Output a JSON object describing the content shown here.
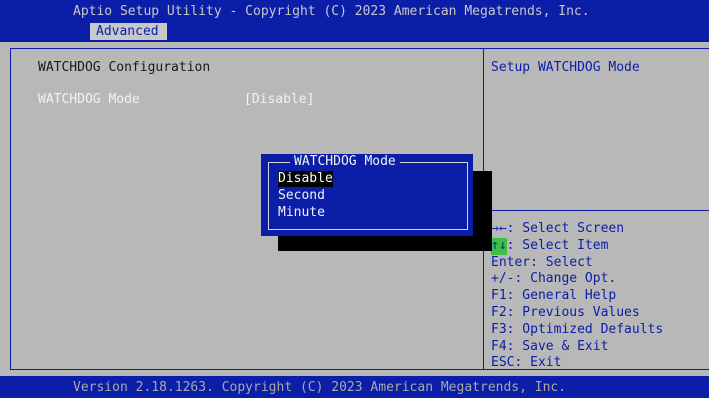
{
  "header": {
    "title": "Aptio Setup Utility - Copyright (C) 2023 American Megatrends, Inc.",
    "active_tab": "Advanced"
  },
  "main": {
    "section_title": "WATCHDOG Configuration",
    "settings": [
      {
        "label": "WATCHDOG Mode",
        "value": "[Disable]"
      }
    ]
  },
  "help": {
    "description": "Setup WATCHDOG Mode",
    "keys": [
      {
        "key": "→←",
        "text": ": Select Screen"
      },
      {
        "key": "↑↓",
        "text": ": Select Item"
      },
      {
        "key": "Enter",
        "text": ": Select"
      },
      {
        "key": "+/-",
        "text": ": Change Opt."
      },
      {
        "key": "F1",
        "text": ": General Help"
      },
      {
        "key": "F2",
        "text": ": Previous Values"
      },
      {
        "key": "F3",
        "text": ": Optimized Defaults"
      },
      {
        "key": "F4",
        "text": ": Save & Exit"
      },
      {
        "key": "ESC",
        "text": ": Exit"
      }
    ]
  },
  "popup": {
    "title": "WATCHDOG Mode",
    "options": [
      "Disable",
      "Second",
      "Minute"
    ],
    "selected_index": 0
  },
  "footer": {
    "text": "Version 2.18.1263. Copyright (C) 2023 American Megatrends, Inc."
  },
  "colors": {
    "bios_blue": "#0b1ea8",
    "background_gray": "#b8b8b8",
    "highlight_green": "#3fbf3f"
  }
}
